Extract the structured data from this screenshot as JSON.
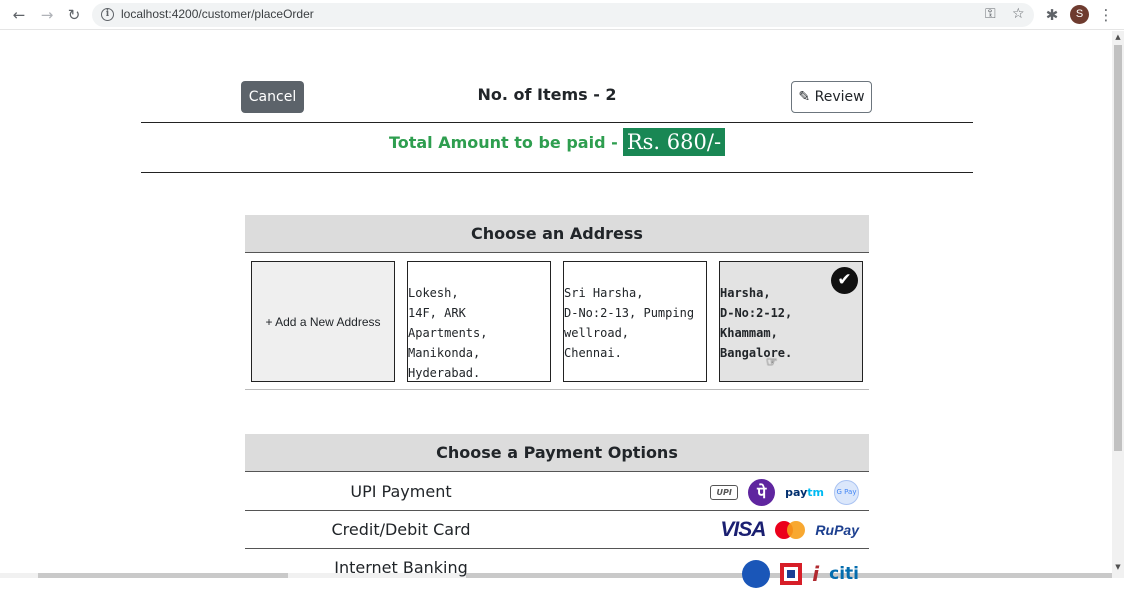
{
  "browser": {
    "url": "localhost:4200/customer/placeOrder",
    "profile_initial": "S"
  },
  "order": {
    "cancel_label": "Cancel",
    "items_count": "No. of Items - 2",
    "review_label": "Review",
    "total_label": "Total Amount to be paid -",
    "total_amount": "Rs. 680/-"
  },
  "address_section": {
    "title": "Choose an Address",
    "add_new_label": "+ Add a New Address",
    "addresses": [
      {
        "lines": [
          "Lokesh,",
          "14F, ARK Apartments,",
          "Manikonda,",
          "Hyderabad."
        ],
        "selected": false
      },
      {
        "lines": [
          "Sri Harsha,",
          "D-No:2-13, Pumping",
          "wellroad,",
          "Chennai."
        ],
        "selected": false
      },
      {
        "lines": [
          "Harsha,",
          "D-No:2-12,",
          "Khammam,",
          "Bangalore."
        ],
        "selected": true
      }
    ]
  },
  "payment_section": {
    "title": "Choose a Payment Options",
    "options": [
      {
        "label": "UPI Payment",
        "logos": [
          "upi",
          "phonepe",
          "paytm",
          "gpay"
        ]
      },
      {
        "label": "Credit/Debit Card",
        "logos": [
          "visa",
          "mastercard",
          "rupay"
        ]
      },
      {
        "label": "Internet Banking",
        "logos": [
          "sbi",
          "hdfc",
          "icici",
          "citi"
        ]
      }
    ],
    "logo_text": {
      "upi": "UPI",
      "phonepe": "पे",
      "paytm_a": "pay",
      "paytm_b": "tm",
      "gpay": "G Pay",
      "visa": "VISA",
      "rupay": "RuPay",
      "icici": "i",
      "citi": "citi"
    }
  },
  "colors": {
    "total_text": "#2e9e4f",
    "total_badge": "#198754",
    "cancel_button": "#5c636a"
  }
}
